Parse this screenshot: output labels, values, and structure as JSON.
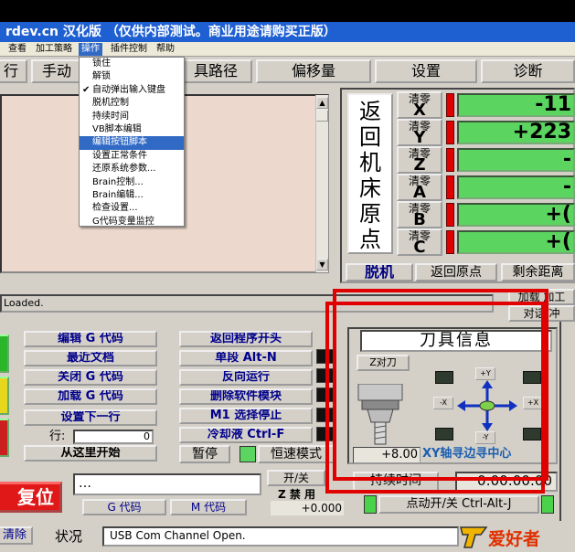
{
  "title": {
    "text": "rdev.cn 汉化版 （仅供内部测试。商业用途请购买正版）"
  },
  "menubar": {
    "items": [
      "查看",
      "加工策略",
      "操作",
      "插件控制",
      "帮助"
    ]
  },
  "tabs": [
    "行",
    "手动",
    "具路径",
    "偏移量",
    "设置",
    "诊断"
  ],
  "dropdown": {
    "items": [
      "锁住",
      "解锁",
      "自动弹出输入键盘",
      "脱机控制",
      "持续时间",
      "VB脚本编辑",
      "编辑按钮脚本",
      "设置正常条件",
      "还原系统参数...",
      "Brain控制...",
      "Brain编辑...",
      "检查设置...",
      "G代码变量监控"
    ],
    "checked_item": "自动弹出输入键盘",
    "highlighted_item": "编辑按钮脚本"
  },
  "dro": {
    "ref_all_label": "返回机床原点",
    "zero_prefix": "清零",
    "axes": [
      "X",
      "Y",
      "Z",
      "A",
      "B",
      "C"
    ],
    "values": [
      "-11",
      "+223",
      "-",
      "-",
      "+(",
      "+("
    ],
    "offline_label": "脱机",
    "return_home_label": "返回原点",
    "remaining_label": "剩余距离"
  },
  "status": {
    "loaded_text": "Loaded."
  },
  "right_buttons": {
    "load_label": "加载 加工",
    "dialog_label": "对话/冲"
  },
  "program_buttons": {
    "left": [
      "编辑 G 代码",
      "最近文档",
      "关闭 G 代码",
      "加载 G 代码",
      "设置下一行"
    ],
    "right": [
      "返回程序开头",
      "单段 Alt-N",
      "反向运行",
      "删除软件模块",
      "M1 选择停止",
      "冷却液 Ctrl-F"
    ],
    "line_label": "行:",
    "line_value": "0",
    "run_from_here": "从这里开始",
    "pause_label": "暂停",
    "cv_label": "恒速模式",
    "reset_label": "复位",
    "gcode_label": "G 代码",
    "mcode_label": "M 代码",
    "open_close_label": "开/关",
    "z_disabled_label": "Z 禁 用",
    "z_value": "+0.000"
  },
  "tool_info": {
    "title": "刀具信息",
    "z_touch_label": "Z对刀",
    "plus_y": "+Y",
    "minus_y": "-Y",
    "plus_x": "+X",
    "minus_x": "-X",
    "tool_value": "+8.00",
    "edge_finder_label": "XY轴寻边寻中心",
    "duration_label": "持续时间",
    "duration_value": "0:00:00:00",
    "jog_label": "点动开/关 Ctrl-Alt-J"
  },
  "bottom": {
    "clear_label": "清除",
    "status_label": "状况",
    "status_text": "USB Com Channel Open.",
    "logo_text": "爱好者"
  },
  "colors": {
    "title_blue": "#1e5fd2",
    "dro_green": "#5bd460",
    "highlight": "#316ac5",
    "red_annotation": "#e00000"
  }
}
